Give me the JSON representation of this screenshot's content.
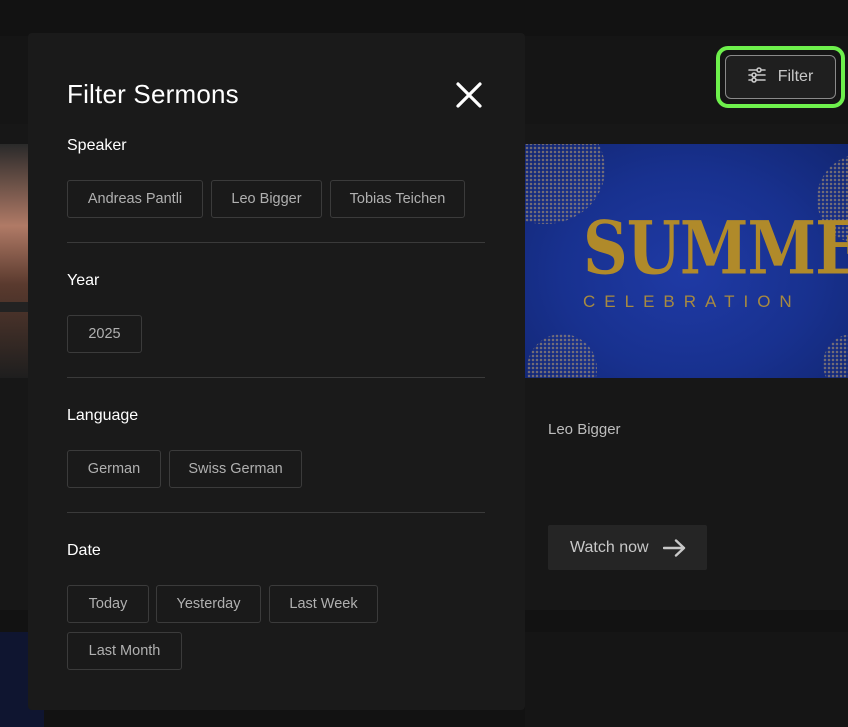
{
  "header": {
    "filter_label": "Filter",
    "filter_icon": "sliders-icon",
    "accent_highlight": "#6ef04c"
  },
  "background_card": {
    "thumbnail_title": "SUMMER",
    "thumbnail_subtitle": "CELEBRATION",
    "speaker": "Leo Bigger",
    "watch_label": "Watch now",
    "watch_icon": "arrow-right-icon"
  },
  "modal": {
    "title": "Filter Sermons",
    "close_icon": "close-icon",
    "sections": {
      "speaker": {
        "title": "Speaker",
        "options": [
          "Andreas Pantli",
          "Leo Bigger",
          "Tobias Teichen"
        ]
      },
      "year": {
        "title": "Year",
        "options": [
          "2025"
        ]
      },
      "language": {
        "title": "Language",
        "options": [
          "German",
          "Swiss German"
        ]
      },
      "date": {
        "title": "Date",
        "options": [
          "Today",
          "Yesterday",
          "Last Week",
          "Last Month"
        ]
      }
    }
  }
}
